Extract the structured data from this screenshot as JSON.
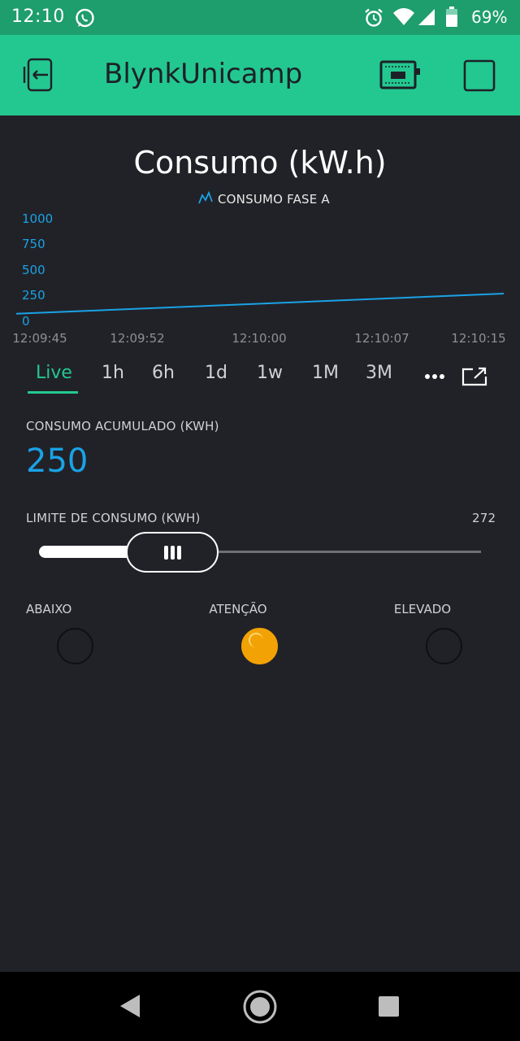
{
  "status_bar": {
    "time": "12:10",
    "battery": "69%",
    "icons": [
      "whatsapp-icon",
      "alarm-icon",
      "wifi-icon",
      "signal-icon",
      "battery-icon"
    ]
  },
  "app_bar": {
    "title": "BlynkUnicamp",
    "icons": [
      "exit-project-icon",
      "device-board-icon",
      "stop-icon"
    ],
    "background": "#23c890"
  },
  "chart": {
    "title": "Consumo (kW.h)",
    "legend": "CONSUMO FASE A",
    "series_color": "#1aa2e6"
  },
  "chart_data": {
    "type": "line",
    "title": "Consumo (kW.h)",
    "series": [
      {
        "name": "CONSUMO FASE A",
        "x": [
          "12:09:45",
          "12:10:15"
        ],
        "y": [
          50,
          250
        ]
      }
    ],
    "x_ticks": [
      "12:09:45",
      "12:09:52",
      "12:10:00",
      "12:10:07",
      "12:10:15"
    ],
    "y_ticks": [
      "1000",
      "750",
      "500",
      "250",
      "0"
    ],
    "ylim": [
      0,
      1000
    ],
    "grid": false
  },
  "time_tabs": {
    "items": [
      "Live",
      "1h",
      "6h",
      "1d",
      "1w",
      "1M",
      "3M"
    ],
    "active": "Live"
  },
  "value_display": {
    "label": "CONSUMO ACUMULADO (KWH)",
    "value": "250"
  },
  "slider": {
    "label": "LIMITE DE CONSUMO (KWH)",
    "value": "272",
    "fraction": 0.24
  },
  "leds": {
    "items": [
      {
        "label": "ABAIXO",
        "on": false
      },
      {
        "label": "ATENÇÃO",
        "on": true,
        "color": "#f2a204"
      },
      {
        "label": "ELEVADO",
        "on": false
      }
    ]
  }
}
